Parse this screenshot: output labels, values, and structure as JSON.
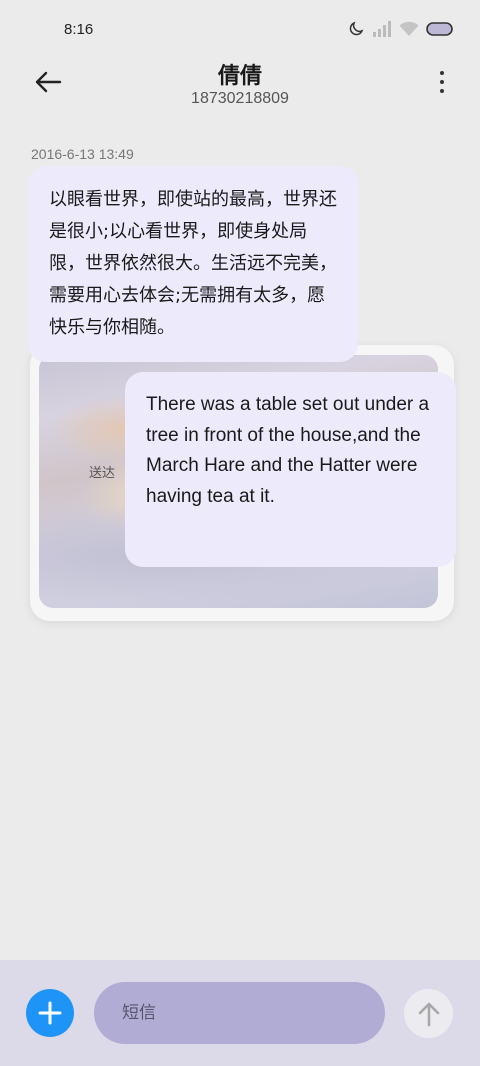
{
  "status_bar": {
    "time": "8:16",
    "icons": [
      "moon-icon",
      "cellular-signal-icon",
      "wifi-icon",
      "battery-icon"
    ]
  },
  "header": {
    "contact_name": "倩倩",
    "contact_number": "18730218809",
    "back_icon": "arrow-left-icon",
    "more_icon": "more-vertical-icon"
  },
  "messages": {
    "timestamp": "2016-6-13 13:49",
    "chinese_text": "以眼看世界，即使站的最高，世界还是很小;以心看世界，即使身处局限，世界依然很大。生活远不完美，需要用心去体会;无需拥有太多，愿快乐与你相随。",
    "delivered_label": "送达",
    "english_text": "There was a table set out under a tree in front of the house,and the March Hare and the Hatter were having tea at it."
  },
  "input_bar": {
    "placeholder": "短信",
    "add_icon": "plus-icon",
    "send_icon": "arrow-up-icon",
    "colors": {
      "add_button": "#1e94f6",
      "input_background": "#b1acd4",
      "bubble": "#edeafc"
    }
  }
}
